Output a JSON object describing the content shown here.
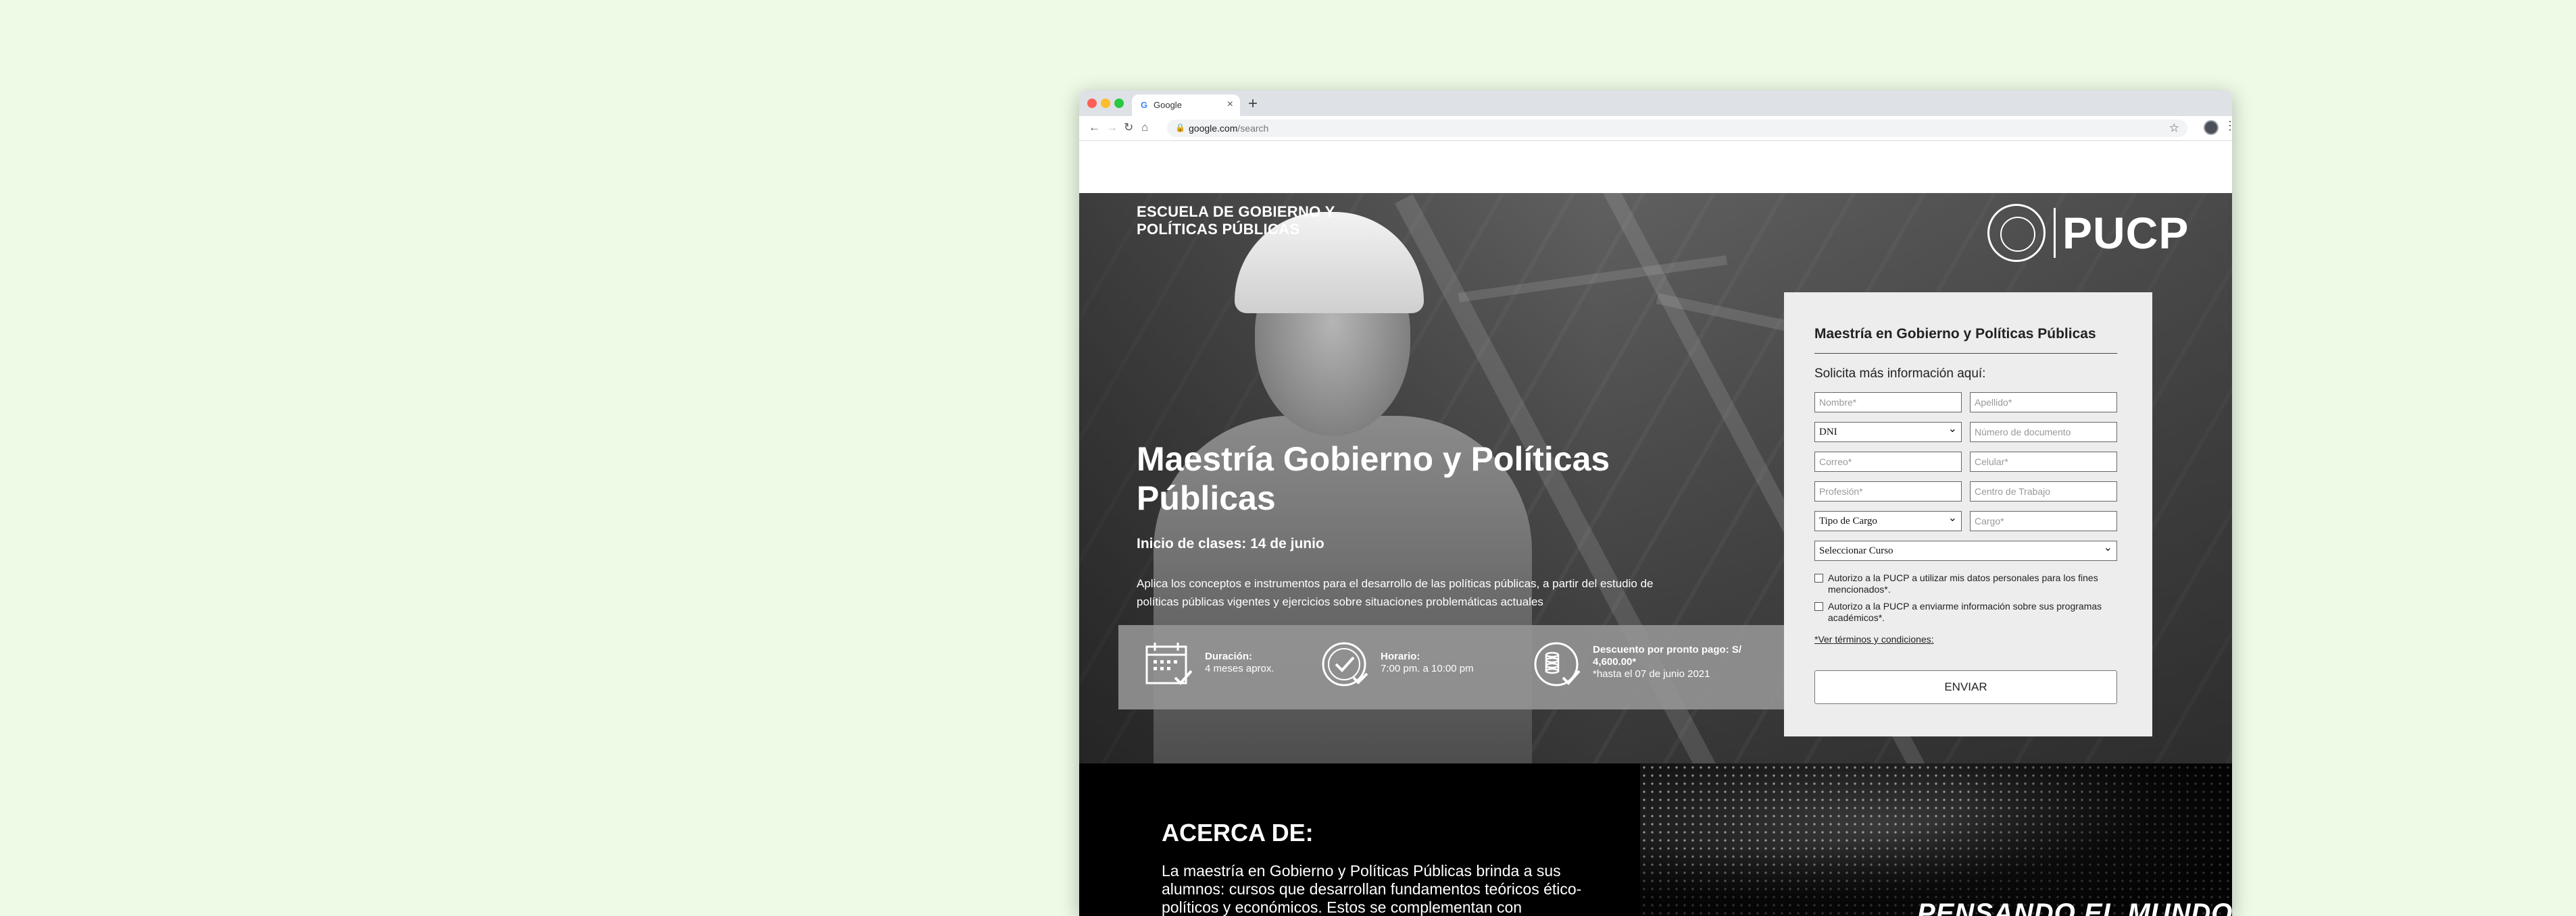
{
  "browser": {
    "tab_title": "Google",
    "tab_favicon": "G",
    "url_host": "google.com",
    "url_path": "/search",
    "icons": [
      "back-icon",
      "forward-icon",
      "reload-icon",
      "home-icon",
      "lock-icon",
      "star-icon",
      "profile-icon",
      "menu-icon",
      "close-icon",
      "new-tab-icon"
    ]
  },
  "hero": {
    "school_name": "ESCUELA DE GOBIERNO Y POLÍTICAS PÚBLICAS",
    "brand": "PUCP",
    "title": "Maestría Gobierno y Políticas Públicas",
    "start_date": "Inicio de clases: 14 de junio",
    "description": "Aplica los conceptos e instrumentos para el desarrollo de las políticas públicas, a partir del estudio de políticas públicas vigentes y ejercicios sobre situaciones problemáticas actuales",
    "info": [
      {
        "label": "Duración:",
        "value": "4 meses aprox.",
        "icon": "calendar-icon"
      },
      {
        "label": "Horario:",
        "value": "7:00 pm. a 10:00 pm",
        "icon": "clock-check-icon"
      },
      {
        "label": "Descuento por pronto pago: S/",
        "label2": "4,600.00*",
        "value": "*hasta el 07 de junio 2021",
        "icon": "coins-icon"
      }
    ]
  },
  "form": {
    "title": "Maestría en Gobierno y Políticas Públicas",
    "subtitle": "Solicita más información aquí:",
    "nombre_placeholder": "Nombre*",
    "apellido_placeholder": "Apellido*",
    "doc_type_selected": "DNI",
    "doc_number_placeholder": "Número de documento",
    "correo_placeholder": "Correo*",
    "celular_placeholder": "Celular*",
    "profesion_placeholder": "Profesión*",
    "centro_placeholder": "Centro de Trabajo",
    "tipo_cargo_selected": "Tipo de Cargo",
    "cargo_placeholder": "Cargo*",
    "curso_selected": "Seleccionar Curso",
    "consent1": "Autorizo a la PUCP a utilizar mis datos personales para los fines mencionados*.",
    "consent2": "Autorizo a la PUCP a enviarme información sobre sus programas académicos*.",
    "terms_link": "*Ver términos y condiciones:",
    "submit_label": "ENVIAR"
  },
  "about": {
    "heading": "ACERCA DE:",
    "text": "La maestría en Gobierno y Políticas Públicas brinda a sus alumnos: cursos que desarrollan fundamentos teóricos ético-políticos y económicos. Estos se complementan con"
  },
  "world": {
    "title": "PENSANDO EL MUNDO"
  }
}
